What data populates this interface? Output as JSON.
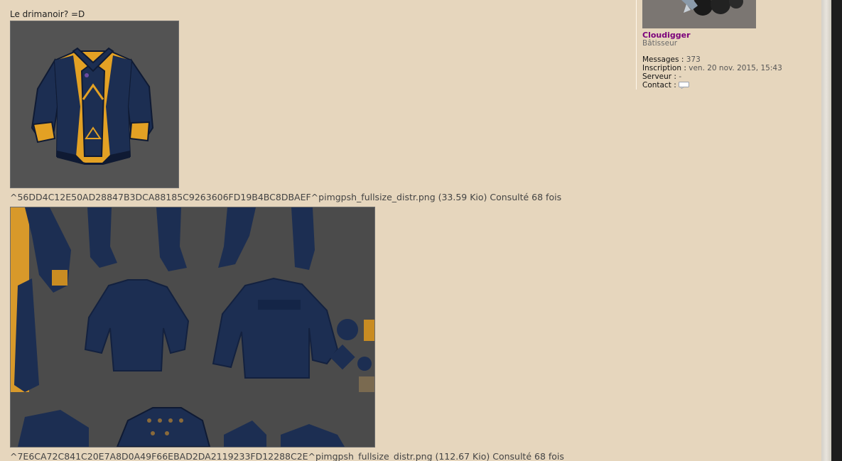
{
  "post": {
    "text": "Le drimanoir? =D",
    "attachments": [
      {
        "caption": "^56DD4C12E50AD28847B3DCA88185C9263606FD19B4BC8DBAEF^pimgpsh_fullsize_distr.png (33.59 Kio) Consulté 68 fois",
        "alt": "blue and gold tunic 3D model"
      },
      {
        "caption": "^7E6CA72C841C20E7A8D0A49F66EBAD2DA2119233FD12288C2E^pimgpsh_fullsize_distr.png (112.67 Kio) Consulté 68 fois",
        "alt": "texture atlas with blue garments"
      }
    ]
  },
  "profile": {
    "username": "Cloudigger",
    "rank": "Bâtisseur",
    "stats": [
      {
        "label": "Messages :",
        "value": "373"
      },
      {
        "label": "Inscription :",
        "value": "ven. 20 nov. 2015, 15:43"
      },
      {
        "label": "Serveur :",
        "value": "-"
      },
      {
        "label": "Contact :",
        "value": ""
      }
    ]
  },
  "colors": {
    "page_bg": "#e6d6bd",
    "username": "#7b007b",
    "tunic_blue": "#1c2e52",
    "tunic_gold": "#e3a124"
  },
  "icons": {
    "contact": "speech-bubble-icon"
  }
}
